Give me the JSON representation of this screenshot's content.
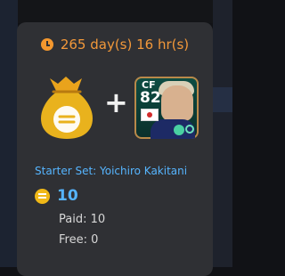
{
  "offer": {
    "timer_text": "265 day(s) 16 hr(s)",
    "set_name": "Starter Set: Yoichiro Kakitani",
    "coin_value": "10",
    "paid_text": "Paid: 10",
    "free_text": "Free: 0"
  },
  "player_card": {
    "position": "CF",
    "rating": "82",
    "nationality": "Japan"
  },
  "icons": {
    "timer": "clock-icon",
    "bag": "money-bag-icon",
    "plus": "plus-icon",
    "coin": "coin-icon",
    "flag": "japan-flag-icon"
  },
  "colors": {
    "accent_orange": "#f2983a",
    "accent_blue": "#56b5ff",
    "coin_gold": "#f0b817",
    "card_bg": "#2f3034"
  }
}
